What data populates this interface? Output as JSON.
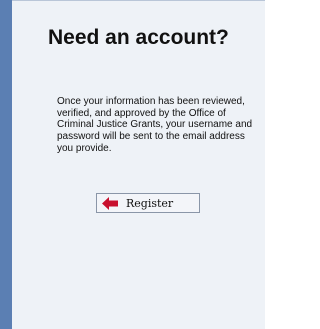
{
  "panel": {
    "heading": "Need an account?",
    "message": "Once your information has been reviewed, verified, and approved by the Office of Criminal Justice Grants, your username and password will be sent to the email address you provide.",
    "register_button": {
      "label": "Register",
      "icon": "arrow-left-icon",
      "icon_color": "#c8102e"
    }
  },
  "colors": {
    "left_bar": "#5b7fb3",
    "panel_background": "#eef2f7"
  }
}
